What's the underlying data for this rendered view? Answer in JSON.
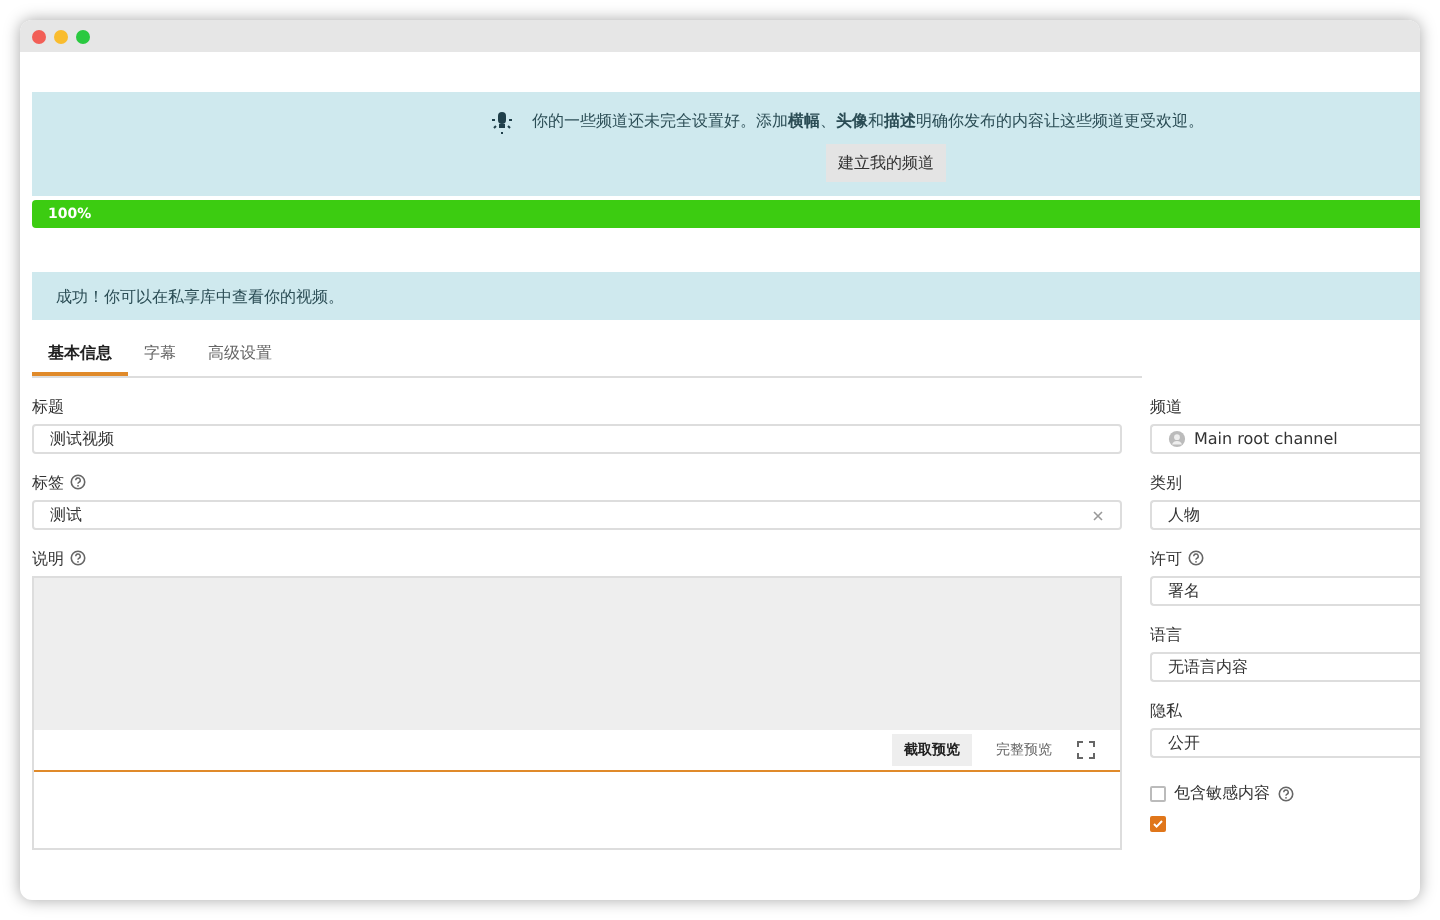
{
  "notice": {
    "text": "你的一些频道还未完全设置好。添加**横幅**、**头像**和**描述**明确你发布的内容让这些频道更受欢迎。",
    "button": "建立我的频道"
  },
  "progress": {
    "level": 1,
    "label": "100%"
  },
  "success": "成功！你可以在私享库中查看你的视频。",
  "tabs": [
    {
      "label": "基本信息",
      "selected": true
    },
    {
      "label": "字幕",
      "selected": false
    },
    {
      "label": "高级设置",
      "selected": false
    }
  ],
  "title_field": {
    "label": "标题",
    "value": "测试视频"
  },
  "tags_field": {
    "label": "标签",
    "value": "测试"
  },
  "description": {
    "label": "说明",
    "tabs": [
      {
        "label": "截取预览",
        "selected": true
      },
      {
        "label": "完整预览",
        "selected": false
      }
    ]
  },
  "side": [
    {
      "label": "频道",
      "value": "Main root channel",
      "avatar": true,
      "help": false
    },
    {
      "label": "类别",
      "value": "人物",
      "avatar": false,
      "help": false
    },
    {
      "label": "许可",
      "value": "署名",
      "avatar": false,
      "help": true
    },
    {
      "label": "语言",
      "value": "无语言内容",
      "avatar": false,
      "help": false
    },
    {
      "label": "隐私",
      "value": "公开",
      "avatar": false,
      "help": false
    }
  ],
  "checks": [
    {
      "label": "包含敏感内容",
      "checked": false,
      "help": true
    },
    {
      "checked": true,
      "help": false
    }
  ]
}
